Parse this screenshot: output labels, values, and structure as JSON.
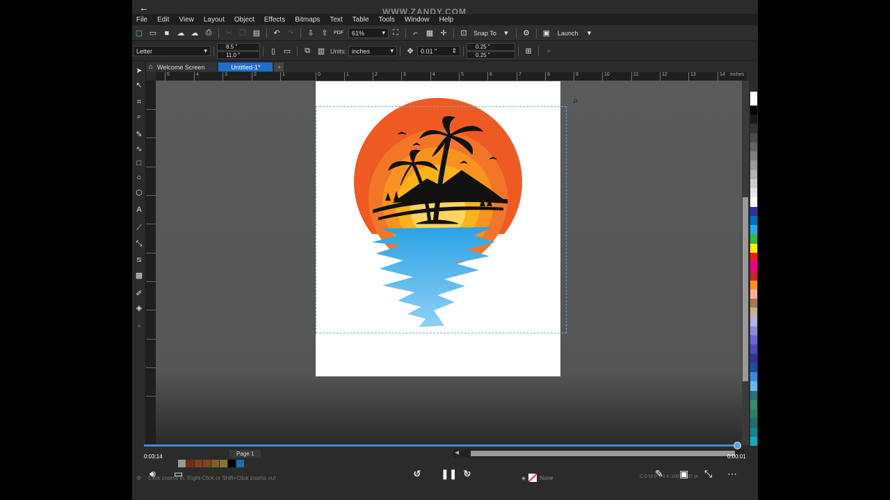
{
  "watermark": "WWW.ZANDY.COM",
  "menu": [
    "File",
    "Edit",
    "View",
    "Layout",
    "Object",
    "Effects",
    "Bitmaps",
    "Text",
    "Table",
    "Tools",
    "Window",
    "Help"
  ],
  "toolbar": {
    "zoom": "61%",
    "snap_to": "Snap To",
    "launch": "Launch"
  },
  "propbar": {
    "page_size": "Letter",
    "width": "8.5 \"",
    "height": "11.0 \"",
    "units_label": "Units:",
    "units": "inches",
    "nudge": "0.01 \"",
    "dup_x": "0.25 \"",
    "dup_y": "0.25 \""
  },
  "tabs": [
    {
      "label": "Welcome Screen"
    },
    {
      "label": "Untitled-1*"
    }
  ],
  "ruler": {
    "unit": "inches",
    "ticks": [
      "5",
      "4",
      "3",
      "2",
      "1",
      "0",
      "1",
      "2",
      "3",
      "4",
      "5",
      "6",
      "7",
      "8",
      "9",
      "10",
      "11",
      "12",
      "13",
      "14"
    ]
  },
  "page_tab": "Page 1",
  "player": {
    "time_elapsed": "0:03:14",
    "time_remaining": "0:00:01",
    "rewind": "10",
    "forward": "30"
  },
  "status": {
    "hint": "Click zooms in, Right-Click or Shift+Click zooms out",
    "fill": "None",
    "coords": "C:0 M:0 Y:0 K:100  0.500 pt"
  },
  "colors": {
    "accent": "#1e6fc9",
    "sun_outer": "#ef5a24",
    "sun_inner": "#f8a21b",
    "water": "#49b1ea"
  }
}
